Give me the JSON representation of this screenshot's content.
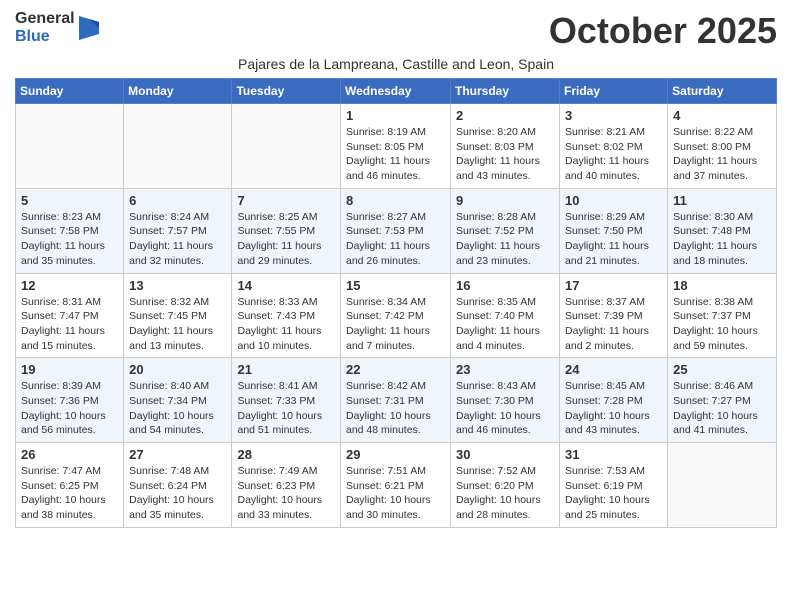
{
  "header": {
    "logo_general": "General",
    "logo_blue": "Blue",
    "month_title": "October 2025",
    "subtitle": "Pajares de la Lampreana, Castille and Leon, Spain"
  },
  "weekdays": [
    "Sunday",
    "Monday",
    "Tuesday",
    "Wednesday",
    "Thursday",
    "Friday",
    "Saturday"
  ],
  "weeks": [
    [
      {
        "day": null,
        "info": null
      },
      {
        "day": null,
        "info": null
      },
      {
        "day": null,
        "info": null
      },
      {
        "day": "1",
        "info": "Sunrise: 8:19 AM\nSunset: 8:05 PM\nDaylight: 11 hours and 46 minutes."
      },
      {
        "day": "2",
        "info": "Sunrise: 8:20 AM\nSunset: 8:03 PM\nDaylight: 11 hours and 43 minutes."
      },
      {
        "day": "3",
        "info": "Sunrise: 8:21 AM\nSunset: 8:02 PM\nDaylight: 11 hours and 40 minutes."
      },
      {
        "day": "4",
        "info": "Sunrise: 8:22 AM\nSunset: 8:00 PM\nDaylight: 11 hours and 37 minutes."
      }
    ],
    [
      {
        "day": "5",
        "info": "Sunrise: 8:23 AM\nSunset: 7:58 PM\nDaylight: 11 hours and 35 minutes."
      },
      {
        "day": "6",
        "info": "Sunrise: 8:24 AM\nSunset: 7:57 PM\nDaylight: 11 hours and 32 minutes."
      },
      {
        "day": "7",
        "info": "Sunrise: 8:25 AM\nSunset: 7:55 PM\nDaylight: 11 hours and 29 minutes."
      },
      {
        "day": "8",
        "info": "Sunrise: 8:27 AM\nSunset: 7:53 PM\nDaylight: 11 hours and 26 minutes."
      },
      {
        "day": "9",
        "info": "Sunrise: 8:28 AM\nSunset: 7:52 PM\nDaylight: 11 hours and 23 minutes."
      },
      {
        "day": "10",
        "info": "Sunrise: 8:29 AM\nSunset: 7:50 PM\nDaylight: 11 hours and 21 minutes."
      },
      {
        "day": "11",
        "info": "Sunrise: 8:30 AM\nSunset: 7:48 PM\nDaylight: 11 hours and 18 minutes."
      }
    ],
    [
      {
        "day": "12",
        "info": "Sunrise: 8:31 AM\nSunset: 7:47 PM\nDaylight: 11 hours and 15 minutes."
      },
      {
        "day": "13",
        "info": "Sunrise: 8:32 AM\nSunset: 7:45 PM\nDaylight: 11 hours and 13 minutes."
      },
      {
        "day": "14",
        "info": "Sunrise: 8:33 AM\nSunset: 7:43 PM\nDaylight: 11 hours and 10 minutes."
      },
      {
        "day": "15",
        "info": "Sunrise: 8:34 AM\nSunset: 7:42 PM\nDaylight: 11 hours and 7 minutes."
      },
      {
        "day": "16",
        "info": "Sunrise: 8:35 AM\nSunset: 7:40 PM\nDaylight: 11 hours and 4 minutes."
      },
      {
        "day": "17",
        "info": "Sunrise: 8:37 AM\nSunset: 7:39 PM\nDaylight: 11 hours and 2 minutes."
      },
      {
        "day": "18",
        "info": "Sunrise: 8:38 AM\nSunset: 7:37 PM\nDaylight: 10 hours and 59 minutes."
      }
    ],
    [
      {
        "day": "19",
        "info": "Sunrise: 8:39 AM\nSunset: 7:36 PM\nDaylight: 10 hours and 56 minutes."
      },
      {
        "day": "20",
        "info": "Sunrise: 8:40 AM\nSunset: 7:34 PM\nDaylight: 10 hours and 54 minutes."
      },
      {
        "day": "21",
        "info": "Sunrise: 8:41 AM\nSunset: 7:33 PM\nDaylight: 10 hours and 51 minutes."
      },
      {
        "day": "22",
        "info": "Sunrise: 8:42 AM\nSunset: 7:31 PM\nDaylight: 10 hours and 48 minutes."
      },
      {
        "day": "23",
        "info": "Sunrise: 8:43 AM\nSunset: 7:30 PM\nDaylight: 10 hours and 46 minutes."
      },
      {
        "day": "24",
        "info": "Sunrise: 8:45 AM\nSunset: 7:28 PM\nDaylight: 10 hours and 43 minutes."
      },
      {
        "day": "25",
        "info": "Sunrise: 8:46 AM\nSunset: 7:27 PM\nDaylight: 10 hours and 41 minutes."
      }
    ],
    [
      {
        "day": "26",
        "info": "Sunrise: 7:47 AM\nSunset: 6:25 PM\nDaylight: 10 hours and 38 minutes."
      },
      {
        "day": "27",
        "info": "Sunrise: 7:48 AM\nSunset: 6:24 PM\nDaylight: 10 hours and 35 minutes."
      },
      {
        "day": "28",
        "info": "Sunrise: 7:49 AM\nSunset: 6:23 PM\nDaylight: 10 hours and 33 minutes."
      },
      {
        "day": "29",
        "info": "Sunrise: 7:51 AM\nSunset: 6:21 PM\nDaylight: 10 hours and 30 minutes."
      },
      {
        "day": "30",
        "info": "Sunrise: 7:52 AM\nSunset: 6:20 PM\nDaylight: 10 hours and 28 minutes."
      },
      {
        "day": "31",
        "info": "Sunrise: 7:53 AM\nSunset: 6:19 PM\nDaylight: 10 hours and 25 minutes."
      },
      {
        "day": null,
        "info": null
      }
    ]
  ]
}
